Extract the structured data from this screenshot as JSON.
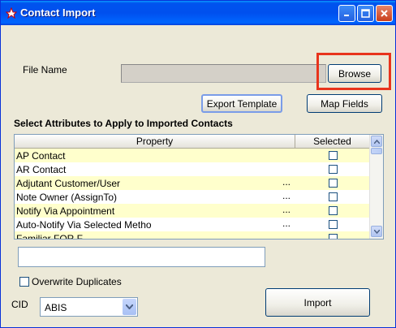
{
  "window": {
    "title": "Contact Import",
    "controls": {
      "minimize": "_",
      "maximize": "□",
      "close": "✕"
    }
  },
  "form": {
    "file_name_label": "File Name",
    "file_name_value": "",
    "browse_label": "Browse",
    "export_template_label": "Export Template",
    "map_fields_label": "Map Fields",
    "attributes_heading": "Select Attributes to Apply to Imported Contacts"
  },
  "table": {
    "columns": [
      "Property",
      "Selected"
    ],
    "rows": [
      {
        "property": "AP Contact",
        "dots": "",
        "selected": false
      },
      {
        "property": "AR Contact",
        "dots": "",
        "selected": false
      },
      {
        "property": "Adjutant Customer/User",
        "dots": "...",
        "selected": false
      },
      {
        "property": "Note Owner (AssignTo)",
        "dots": "...",
        "selected": false
      },
      {
        "property": "Notify Via Appointment",
        "dots": "...",
        "selected": false
      },
      {
        "property": "Auto-Notify Via Selected Metho",
        "dots": "...",
        "selected": false
      },
      {
        "property": "Familiar FOR F...",
        "dots": "",
        "selected": false
      }
    ]
  },
  "options": {
    "status_text": "",
    "overwrite_label": "Overwrite Duplicates",
    "overwrite_checked": false,
    "cid_label": "CID",
    "cid_value": "ABIS",
    "import_label": "Import"
  },
  "colors": {
    "highlight": "#e8341c",
    "row_alt": "#ffffcc",
    "titlebar": "#0053ee"
  }
}
